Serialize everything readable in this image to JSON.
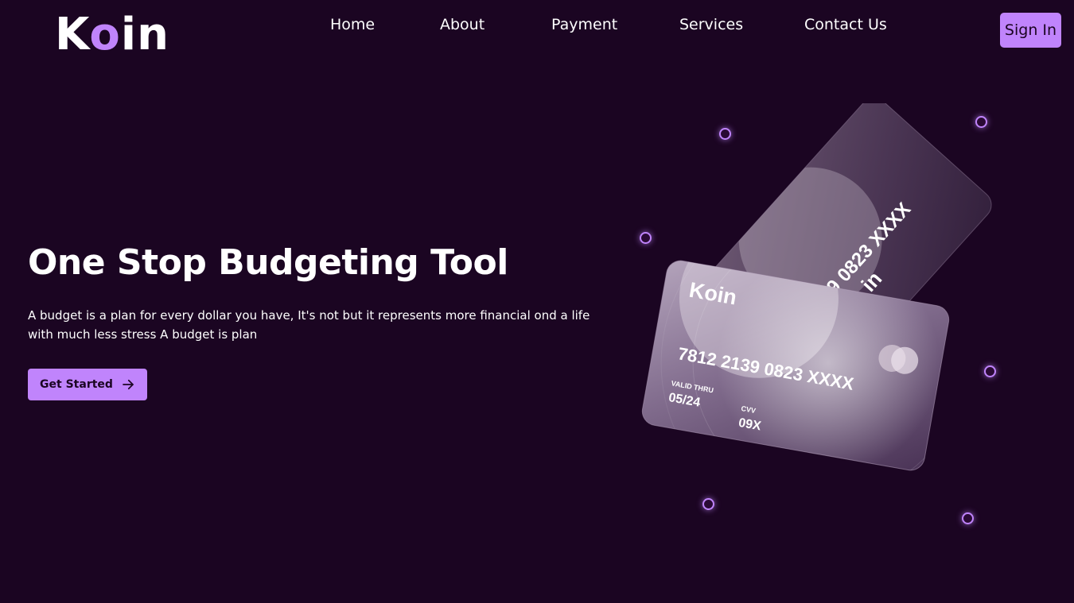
{
  "brand": {
    "logo_prefix": "K",
    "logo_accent": "o",
    "logo_suffix": "in"
  },
  "nav": {
    "items": [
      {
        "label": "Home"
      },
      {
        "label": "About"
      },
      {
        "label": "Payment"
      },
      {
        "label": "Services"
      },
      {
        "label": "Contact Us"
      }
    ],
    "signin_label": "Sign In"
  },
  "hero": {
    "title": "One Stop Budgeting Tool",
    "description": "A budget is a plan for every dollar you have, It's not but it represents more financial ond a life with much less stress A budget is plan",
    "cta_label": "Get Started",
    "cta_icon": "arrow-right-icon"
  },
  "cards": {
    "front": {
      "brand": "Koin",
      "number": "7812 2139 0823 XXXX",
      "valid_label": "VALID THRU",
      "valid_value": "05/24",
      "cvv_label": "CVV",
      "cvv_value": "09X"
    },
    "back": {
      "brand_partial": "in",
      "number_partial": "39 0823 XXXX"
    }
  },
  "colors": {
    "background": "#1b0522",
    "accent": "#c084fc",
    "text": "#ffffff"
  }
}
